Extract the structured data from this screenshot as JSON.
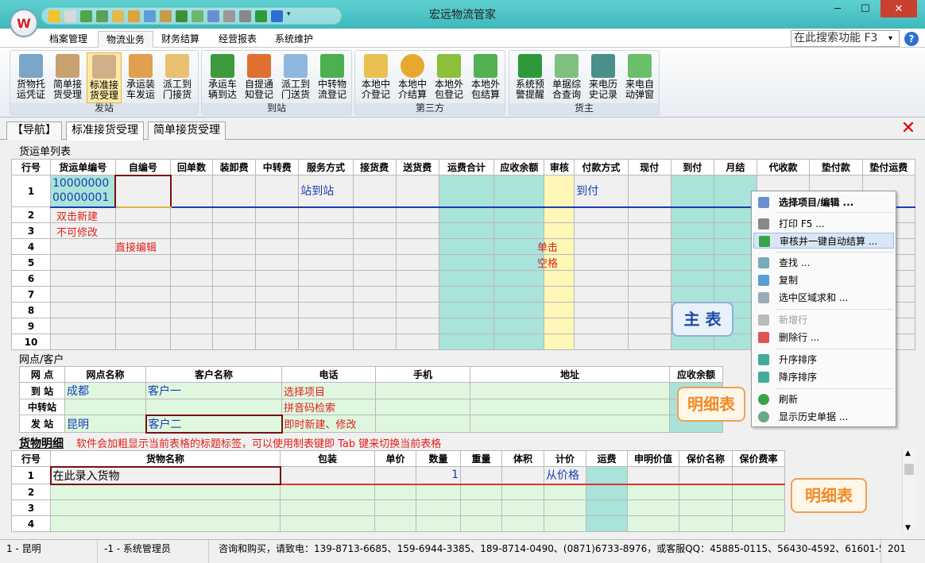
{
  "titlebar": {
    "title": "宏远物流管家",
    "minimize": "─",
    "maximize": "☐",
    "close": "✕"
  },
  "menu": {
    "items": [
      "档案管理",
      "物流业务",
      "财务结算",
      "经营报表",
      "系统维护"
    ],
    "search_value": "在此搜索功能 F3",
    "help": "?"
  },
  "ribbon": {
    "groups": [
      {
        "label": "发站",
        "buttons": [
          "货物托\n运凭证",
          "简单接\n货受理",
          "标准接\n货受理",
          "承运装\n车发运",
          "派工到\n门接货"
        ]
      },
      {
        "label": "到站",
        "buttons": [
          "承运车\n辆到达",
          "自提通\n知登记",
          "派工到\n门送货",
          "中转物\n流登记"
        ]
      },
      {
        "label": "第三方",
        "buttons": [
          "本地中\n介登记",
          "本地中\n介结算",
          "本地外\n包登记",
          "本地外\n包结算"
        ]
      },
      {
        "label": "货主",
        "buttons": [
          "系统预\n警提醒",
          "单据综\n合查询",
          "来电历\n史记录",
          "来电自\n动弹窗"
        ]
      }
    ]
  },
  "doctabs": {
    "nav": "【导航】",
    "tab1": "标准接货受理",
    "tab2": "简单接货受理",
    "close": "✕"
  },
  "main_table": {
    "section_label": "货运单列表",
    "headers": [
      "行号",
      "货运单编号",
      "自编号",
      "回单数",
      "装卸费",
      "中转费",
      "服务方式",
      "接货费",
      "送货费",
      "运费合计",
      "应收余额",
      "审核",
      "付款方式",
      "现付",
      "到付",
      "月结",
      "代收款",
      "垫付款",
      "垫付运费"
    ],
    "row1": {
      "no": "1",
      "waybill_a": "10000000",
      "waybill_b": "00000001",
      "service": "站到站",
      "payment": "到付"
    },
    "row_numbers": [
      "2",
      "3",
      "4",
      "5",
      "6",
      "7",
      "8",
      "9",
      "10"
    ],
    "notes": {
      "dbl_click": "双击新建",
      "no_modify": "不可修改",
      "direct_edit": "直接编辑",
      "click1": "单击",
      "click2": "空格"
    }
  },
  "outlet_table": {
    "section_label": "网点/客户",
    "headers": [
      "网  点",
      "网点名称",
      "客户名称",
      "电话",
      "手机",
      "地址",
      "应收余额"
    ],
    "rows": [
      {
        "label": "到  站",
        "name": "成都",
        "customer": "客户一",
        "note": "选择项目"
      },
      {
        "label": "中转站",
        "name": "",
        "customer": "",
        "note": "拼音码检索"
      },
      {
        "label": "发  站",
        "name": "昆明",
        "customer": "客户二",
        "note": "即时新建、修改"
      }
    ]
  },
  "goods_table": {
    "section_label": "货物明细",
    "hint": "软件会加粗显示当前表格的标题标签，可以使用制表键即 Tab 键来切换当前表格",
    "headers": [
      "行号",
      "货物名称",
      "包装",
      "单价",
      "数量",
      "重量",
      "体积",
      "计价",
      "运费",
      "申明价值",
      "保价名称",
      "保价费率"
    ],
    "row1": {
      "no": "1",
      "name": "在此录入货物",
      "qty": "1",
      "pricing": "从价格"
    },
    "row_numbers": [
      "2",
      "3",
      "4"
    ]
  },
  "context_menu": {
    "items": [
      "选择项目/编辑 ...",
      "打印 F5 ...",
      "审核并一键自动结算 ...",
      "查找 ...",
      "复制",
      "选中区域求和 ...",
      "新增行",
      "删除行 ...",
      "升序排序",
      "降序排序",
      "刷新",
      "显示历史单据 ..."
    ]
  },
  "badges": {
    "main": "主 表",
    "detail1": "明细表",
    "detail2": "明细表"
  },
  "status": {
    "outlet": "1 - 昆明",
    "user": "-1 - 系统管理员",
    "contact": "咨询和购买，请致电：139-8713-6685、159-6944-3385、189-8714-0490、(0871)6733-8976，或客服QQ：45885-0115、56430-4592、61601-5435",
    "year": "201"
  },
  "colors": {
    "titlebar": "#3fb8bb",
    "teal_cell": "#a9e3d9",
    "green_cell": "#dff7df",
    "yellow_cell": "#fff7b8",
    "annotation_red": "#e0201a",
    "badge_blue": "#1f49a8",
    "badge_orange": "#f08a24"
  }
}
